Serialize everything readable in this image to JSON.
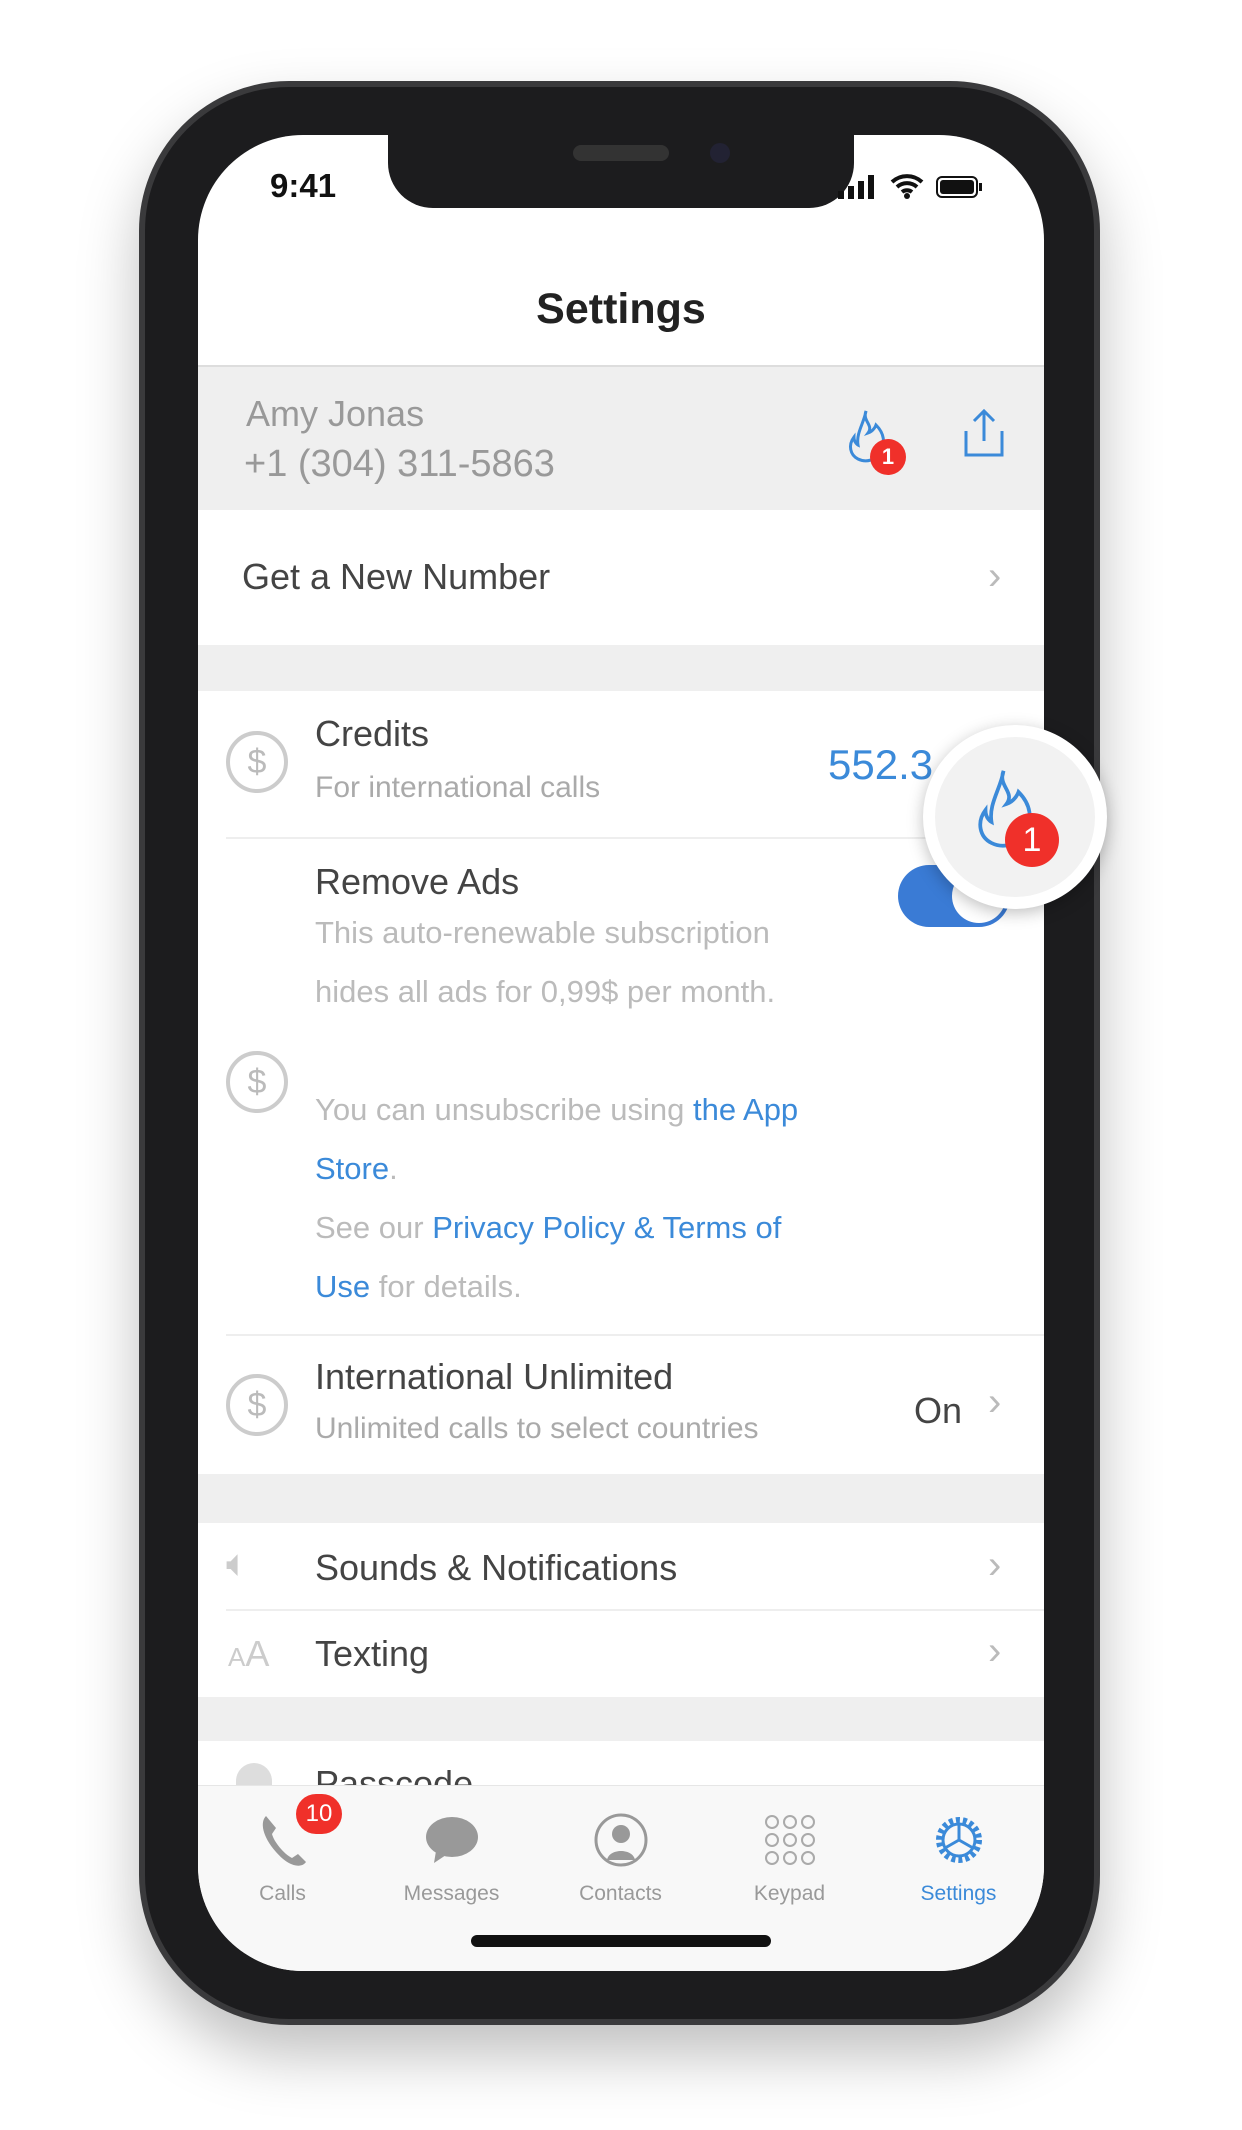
{
  "status_bar": {
    "time": "9:41"
  },
  "header": {
    "title": "Settings"
  },
  "profile": {
    "name": "Amy Jonas",
    "phone": "+1 (304) 311-5863",
    "fire_badge": "1"
  },
  "rows": {
    "new_number": {
      "label": "Get a New Number"
    },
    "credits": {
      "label": "Credits",
      "subtitle": "For international calls",
      "value": "552.3"
    },
    "remove_ads": {
      "label": "Remove Ads",
      "desc1": "This auto-renewable subscription",
      "desc2": "hides all ads for 0,99$ per month.",
      "desc3": "You can unsubscribe using ",
      "link_app_store_1": "the App",
      "link_app_store_2": "Store",
      "desc4": ".",
      "desc5": "See our ",
      "link_privacy_1": "Privacy Policy & Terms of",
      "link_privacy_2": "Use",
      "desc6": " for details.",
      "toggle_on": true
    },
    "intl": {
      "label": "International Unlimited",
      "subtitle": "Unlimited calls to select countries",
      "value": "On"
    },
    "sounds": {
      "label": "Sounds & Notifications"
    },
    "texting": {
      "label": "Texting"
    },
    "passcode": {
      "label": "Passcode"
    }
  },
  "floating": {
    "badge": "1"
  },
  "tabbar": {
    "items": [
      {
        "label": "Calls",
        "badge": "10"
      },
      {
        "label": "Messages"
      },
      {
        "label": "Contacts"
      },
      {
        "label": "Keypad"
      },
      {
        "label": "Settings",
        "active": true
      }
    ]
  },
  "colors": {
    "accent": "#3b8ad9",
    "badge": "#f0302a"
  }
}
